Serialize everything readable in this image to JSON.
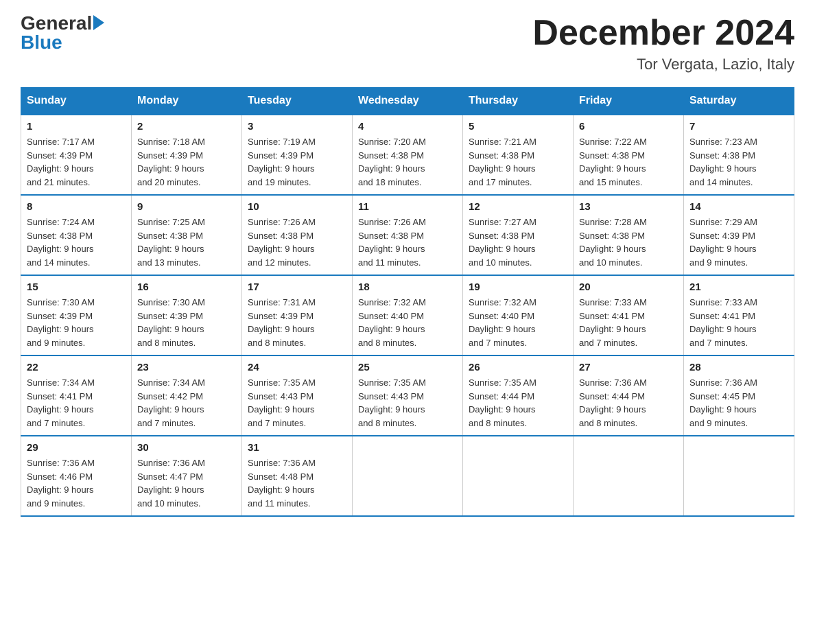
{
  "logo": {
    "general": "General",
    "blue": "Blue"
  },
  "header": {
    "month": "December 2024",
    "location": "Tor Vergata, Lazio, Italy"
  },
  "days_of_week": [
    "Sunday",
    "Monday",
    "Tuesday",
    "Wednesday",
    "Thursday",
    "Friday",
    "Saturday"
  ],
  "weeks": [
    [
      {
        "day": "1",
        "sunrise": "7:17 AM",
        "sunset": "4:39 PM",
        "daylight": "9 hours and 21 minutes."
      },
      {
        "day": "2",
        "sunrise": "7:18 AM",
        "sunset": "4:39 PM",
        "daylight": "9 hours and 20 minutes."
      },
      {
        "day": "3",
        "sunrise": "7:19 AM",
        "sunset": "4:39 PM",
        "daylight": "9 hours and 19 minutes."
      },
      {
        "day": "4",
        "sunrise": "7:20 AM",
        "sunset": "4:38 PM",
        "daylight": "9 hours and 18 minutes."
      },
      {
        "day": "5",
        "sunrise": "7:21 AM",
        "sunset": "4:38 PM",
        "daylight": "9 hours and 17 minutes."
      },
      {
        "day": "6",
        "sunrise": "7:22 AM",
        "sunset": "4:38 PM",
        "daylight": "9 hours and 15 minutes."
      },
      {
        "day": "7",
        "sunrise": "7:23 AM",
        "sunset": "4:38 PM",
        "daylight": "9 hours and 14 minutes."
      }
    ],
    [
      {
        "day": "8",
        "sunrise": "7:24 AM",
        "sunset": "4:38 PM",
        "daylight": "9 hours and 14 minutes."
      },
      {
        "day": "9",
        "sunrise": "7:25 AM",
        "sunset": "4:38 PM",
        "daylight": "9 hours and 13 minutes."
      },
      {
        "day": "10",
        "sunrise": "7:26 AM",
        "sunset": "4:38 PM",
        "daylight": "9 hours and 12 minutes."
      },
      {
        "day": "11",
        "sunrise": "7:26 AM",
        "sunset": "4:38 PM",
        "daylight": "9 hours and 11 minutes."
      },
      {
        "day": "12",
        "sunrise": "7:27 AM",
        "sunset": "4:38 PM",
        "daylight": "9 hours and 10 minutes."
      },
      {
        "day": "13",
        "sunrise": "7:28 AM",
        "sunset": "4:38 PM",
        "daylight": "9 hours and 10 minutes."
      },
      {
        "day": "14",
        "sunrise": "7:29 AM",
        "sunset": "4:39 PM",
        "daylight": "9 hours and 9 minutes."
      }
    ],
    [
      {
        "day": "15",
        "sunrise": "7:30 AM",
        "sunset": "4:39 PM",
        "daylight": "9 hours and 9 minutes."
      },
      {
        "day": "16",
        "sunrise": "7:30 AM",
        "sunset": "4:39 PM",
        "daylight": "9 hours and 8 minutes."
      },
      {
        "day": "17",
        "sunrise": "7:31 AM",
        "sunset": "4:39 PM",
        "daylight": "9 hours and 8 minutes."
      },
      {
        "day": "18",
        "sunrise": "7:32 AM",
        "sunset": "4:40 PM",
        "daylight": "9 hours and 8 minutes."
      },
      {
        "day": "19",
        "sunrise": "7:32 AM",
        "sunset": "4:40 PM",
        "daylight": "9 hours and 7 minutes."
      },
      {
        "day": "20",
        "sunrise": "7:33 AM",
        "sunset": "4:41 PM",
        "daylight": "9 hours and 7 minutes."
      },
      {
        "day": "21",
        "sunrise": "7:33 AM",
        "sunset": "4:41 PM",
        "daylight": "9 hours and 7 minutes."
      }
    ],
    [
      {
        "day": "22",
        "sunrise": "7:34 AM",
        "sunset": "4:41 PM",
        "daylight": "9 hours and 7 minutes."
      },
      {
        "day": "23",
        "sunrise": "7:34 AM",
        "sunset": "4:42 PM",
        "daylight": "9 hours and 7 minutes."
      },
      {
        "day": "24",
        "sunrise": "7:35 AM",
        "sunset": "4:43 PM",
        "daylight": "9 hours and 7 minutes."
      },
      {
        "day": "25",
        "sunrise": "7:35 AM",
        "sunset": "4:43 PM",
        "daylight": "9 hours and 8 minutes."
      },
      {
        "day": "26",
        "sunrise": "7:35 AM",
        "sunset": "4:44 PM",
        "daylight": "9 hours and 8 minutes."
      },
      {
        "day": "27",
        "sunrise": "7:36 AM",
        "sunset": "4:44 PM",
        "daylight": "9 hours and 8 minutes."
      },
      {
        "day": "28",
        "sunrise": "7:36 AM",
        "sunset": "4:45 PM",
        "daylight": "9 hours and 9 minutes."
      }
    ],
    [
      {
        "day": "29",
        "sunrise": "7:36 AM",
        "sunset": "4:46 PM",
        "daylight": "9 hours and 9 minutes."
      },
      {
        "day": "30",
        "sunrise": "7:36 AM",
        "sunset": "4:47 PM",
        "daylight": "9 hours and 10 minutes."
      },
      {
        "day": "31",
        "sunrise": "7:36 AM",
        "sunset": "4:48 PM",
        "daylight": "9 hours and 11 minutes."
      },
      null,
      null,
      null,
      null
    ]
  ]
}
